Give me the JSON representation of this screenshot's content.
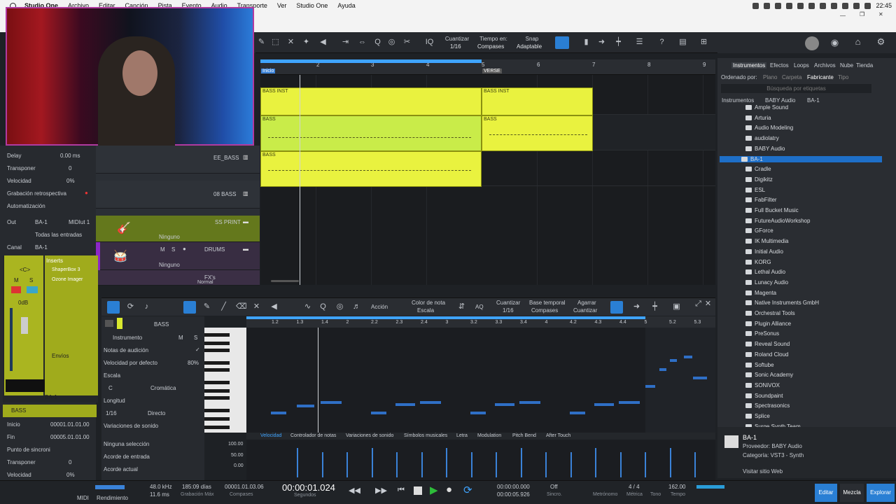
{
  "menu": {
    "app": "Studio One",
    "items": [
      "Archivo",
      "Editar",
      "Canción",
      "Pista",
      "Evento",
      "Audio",
      "Transporte",
      "Ver",
      "Studio One",
      "Ayuda"
    ],
    "clock": "22:45"
  },
  "toolbar": {
    "quantize_label": "Cuantizar",
    "quantize_val": "1/16",
    "timebase_label": "Tiempo en:",
    "timebase_val": "Compases",
    "snap_label": "Snap",
    "snap_val": "Adaptable"
  },
  "ruler": {
    "bars": [
      "2",
      "3",
      "4",
      "5",
      "6",
      "7",
      "8",
      "9"
    ],
    "marker_start": "Inicio",
    "marker_verse": "VERSE"
  },
  "clips": {
    "c1": "BASS INST",
    "c2": "BASS",
    "c3": "BASS",
    "c4": "BASS INST",
    "c5": "BASS"
  },
  "tracks": {
    "t1": "EE_BASS",
    "t2": "08 BASS",
    "t3": "SS PRINT",
    "t4": "DRUMS",
    "t5": "FX's",
    "none": "Ninguno",
    "mode": "Normal"
  },
  "inspector": {
    "delay_label": "Delay",
    "delay_val": "0.00 ms",
    "transpose_label": "Transponer",
    "transpose_val": "0",
    "velocity_label": "Velocidad",
    "velocity_val": "0%",
    "retro_label": "Grabación retrospectiva",
    "auto_label": "Automatización",
    "out_label": "Out",
    "out_val": "BA-1",
    "out_port": "MIDIut 1",
    "in_val": "Todas las entradas",
    "channel_label": "Canal",
    "channel_val": "BA-1",
    "inserts": "Inserts",
    "ins1": "ShaperBox 3",
    "ins2": "Ozone Imager",
    "sends": "Envíos",
    "vol": "0dB",
    "strip": "BA-1",
    "mute": "M",
    "solo": "S",
    "pan": "<C>",
    "track_name": "BASS",
    "start_label": "Inicio",
    "start_val": "00001.01.01.00",
    "end_label": "Fin",
    "end_val": "00005.01.01.00",
    "cue_label": "Punto de sincroni",
    "tr2_label": "Transponer",
    "tr2_val": "0",
    "vel2_label": "Velocidad",
    "vel2_val": "0%"
  },
  "editor": {
    "track": "BASS",
    "instrument": "Instrumento",
    "notes": "Notas de audición",
    "vel_default": "Velocidad por defecto",
    "vel_default_val": "80%",
    "scale": "Escala",
    "key": "C",
    "scale_type": "Cromática",
    "length": "Longitud",
    "length_val": "1/16",
    "mode": "Directo",
    "variations": "Variaciones de sonido",
    "none_sel": "Ninguna selección",
    "chord_in": "Acorde de entrada",
    "chord_now": "Acorde actual",
    "action": "Acción",
    "note_color_label": "Color de nota",
    "note_color_val": "Escala",
    "aq": "AQ",
    "quant_label": "Cuantizar",
    "quant_val": "1/16",
    "base_label": "Base temporal",
    "base_val": "Compases",
    "grab_label": "Agarrar",
    "grab_val": "Cuantizar",
    "ruler": [
      "1.2",
      "1.3",
      "1.4",
      "2",
      "2.2",
      "2.3",
      "2.4",
      "3",
      "3.2",
      "3.3",
      "3.4",
      "4",
      "4.2",
      "4.3",
      "4.4",
      "5",
      "5.2",
      "5.3"
    ],
    "tabs": [
      "Velocidad",
      "Controlador de notas",
      "Variaciones de sonido",
      "Símbolos musicales",
      "Letra",
      "Modulation",
      "Pitch Bend",
      "After Touch"
    ],
    "vel_scale": [
      "100.00",
      "50.00",
      "0.00"
    ]
  },
  "browser": {
    "tabs": [
      "Instrumentos",
      "Efectos",
      "Loops",
      "Archivos",
      "Nube",
      "Tienda"
    ],
    "sort_label": "Ordenado por:",
    "sort": [
      "Plano",
      "Carpeta",
      "Fabricante",
      "Tipo"
    ],
    "search": "Búsqueda por etiquetas",
    "path": [
      "Instrumentos",
      "BABY Audio",
      "BA-1"
    ],
    "items": [
      "Ample Sound",
      "Arturia",
      "Audio Modeling",
      "audiolatry",
      "BABY Audio",
      "BA-1",
      "Cradle",
      "Digikitz",
      "ESL",
      "FabFilter",
      "Full Bucket Music",
      "FutureAudioWorkshop",
      "GForce",
      "IK Multimedia",
      "Initial Audio",
      "KORG",
      "Lethal Audio",
      "Lunacy Audio",
      "Magenta",
      "Native Instruments GmbH",
      "Orchestral Tools",
      "Plugin Alliance",
      "PreSonus",
      "Reveal Sound",
      "Roland Cloud",
      "Softube",
      "Sonic Academy",
      "SONiVOX",
      "Soundpaint",
      "Spectrasonics",
      "Splice",
      "Surge Synth Team"
    ],
    "info_name": "BA-1",
    "info_vendor": "Proveedor: BABY Audio",
    "info_cat": "Categoría: VST3 - Synth",
    "info_link": "Visitar sitio Web"
  },
  "transport": {
    "midi": "MIDI",
    "render": "Rendimiento",
    "rate": "48.0 kHz",
    "lat": "11.6 ms",
    "days": "185:09 días",
    "maxrec": "Grabación Máx",
    "pos": "00001.01.03.06",
    "pos_label": "Compases",
    "time": "00:00:01.024",
    "time_label": "Segundos",
    "l": "00:00:00.000",
    "r": "00:00:05.926",
    "sync": "Off",
    "sync_label": "Sincro.",
    "metro": "Metrónomo",
    "sig": "4 / 4",
    "sig_label": "Métrica",
    "key_label": "Tono",
    "tempo": "162.00",
    "tempo_label": "Tempo",
    "edit": "Editar",
    "mix": "Mezcla",
    "browse": "Explorar"
  }
}
